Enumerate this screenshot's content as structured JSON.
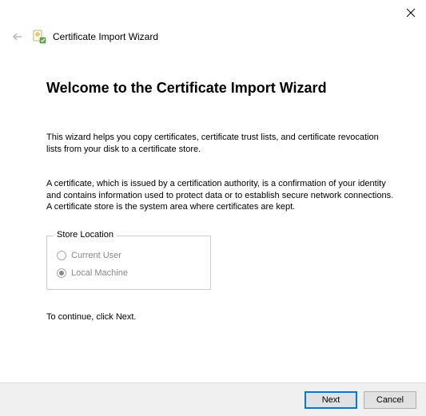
{
  "header": {
    "title": "Certificate Import Wizard"
  },
  "main": {
    "heading": "Welcome to the Certificate Import Wizard",
    "intro": "This wizard helps you copy certificates, certificate trust lists, and certificate revocation lists from your disk to a certificate store.",
    "explain": "A certificate, which is issued by a certification authority, is a confirmation of your identity and contains information used to protect data or to establish secure network connections. A certificate store is the system area where certificates are kept.",
    "groupbox_label": "Store Location",
    "radios": {
      "current_user": "Current User",
      "local_machine": "Local Machine"
    },
    "continue_text": "To continue, click Next."
  },
  "buttons": {
    "next": "Next",
    "cancel": "Cancel"
  }
}
